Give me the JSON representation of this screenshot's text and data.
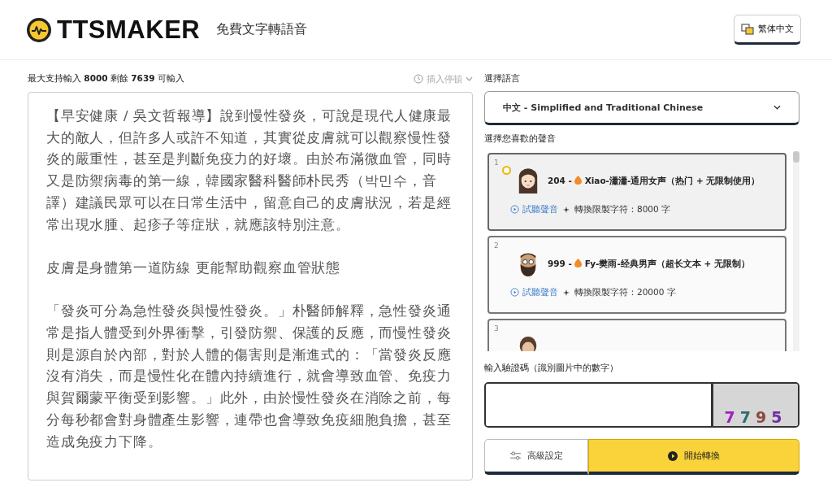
{
  "header": {
    "logo": "TTSMAKER",
    "tagline": "免費文字轉語音",
    "language_button": "繁体中文"
  },
  "editor": {
    "counter": "最大支持輸入 **8000** 剩餘 **7639** 可輸入",
    "insert_pause": "插入停頓",
    "paragraphs": [
      "【早安健康 / 吳文哲報導】說到慢性發炎，可說是現代人健康最大的敵人，但許多人或許不知道，其實從皮膚就可以觀察慢性發炎的嚴重性，甚至是判斷免疫力的好壞。由於布滿微血管，同時又是防禦病毒的第一線，韓國家醫科醫師朴民秀（박민수，音譯）建議民眾可以在日常生活中，留意自己的皮膚狀況，若是經常出現水腫、起疹子等症狀，就應該特別注意。",
      "皮膚是身體第一道防線 更能幫助觀察血管狀態",
      "「發炎可分為急性發炎與慢性發炎。」朴醫師解釋，急性發炎通常是指人體受到外界衝擊，引發防禦、保護的反應，而慢性發炎則是源自於內部，對於人體的傷害則是漸進式的：「當發炎反應沒有消失，而是慢性化在體內持續進行，就會導致血管、免疫力與賀爾蒙平衡受到影響。」此外，由於慢性發炎在消除之前，每分每秒都會對身體產生影響，連帶也會導致免疫細胞負擔，甚至造成免疫力下降。"
    ]
  },
  "language": {
    "label": "選擇語言",
    "value": "中文 - Simplified and Traditional Chinese"
  },
  "voices": {
    "label": "選擇您喜歡的聲音",
    "items": [
      {
        "index": "1",
        "kind": "girl",
        "selected": true,
        "code": "204 -",
        "name": "Xiao-瀟瀟-通用女声（热门 + 无限制使用）",
        "preview": "試聽聲音",
        "limit": "轉換限製字符：8000 字"
      },
      {
        "index": "2",
        "kind": "man",
        "selected": false,
        "code": "999 -",
        "name": "Fy-樊雨-经典男声（超长文本 + 无限制）",
        "preview": "試聽聲音",
        "limit": "轉換限製字符：20000 字"
      },
      {
        "index": "3",
        "kind": "boy",
        "selected": false
      }
    ]
  },
  "captcha": {
    "label": "輸入驗證碼（識別圖片中的數字）",
    "code": "7795"
  },
  "buttons": {
    "advanced": "高級設定",
    "convert": "開始轉換"
  }
}
